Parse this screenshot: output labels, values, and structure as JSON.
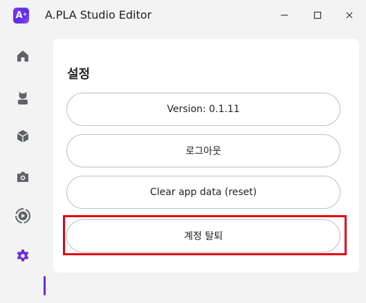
{
  "window": {
    "logo_text": "A",
    "title": "A.PLA Studio Editor",
    "controls": [
      "minimize",
      "maximize",
      "close"
    ]
  },
  "sidebar": {
    "items": [
      {
        "icon": "home-icon"
      },
      {
        "icon": "avatar-icon"
      },
      {
        "icon": "cube-icon"
      },
      {
        "icon": "camera-icon"
      },
      {
        "icon": "play-icon"
      },
      {
        "icon": "gear-icon",
        "active": true
      }
    ]
  },
  "settings": {
    "title": "설정",
    "version_label": "Version: 0.1.11",
    "logout_label": "로그아웃",
    "clear_label": "Clear app data (reset)",
    "delete_account_label": "계정 탈퇴"
  },
  "colors": {
    "accent": "#6b2bd8",
    "highlight": "#e3000f",
    "icon": "#5f6368"
  }
}
